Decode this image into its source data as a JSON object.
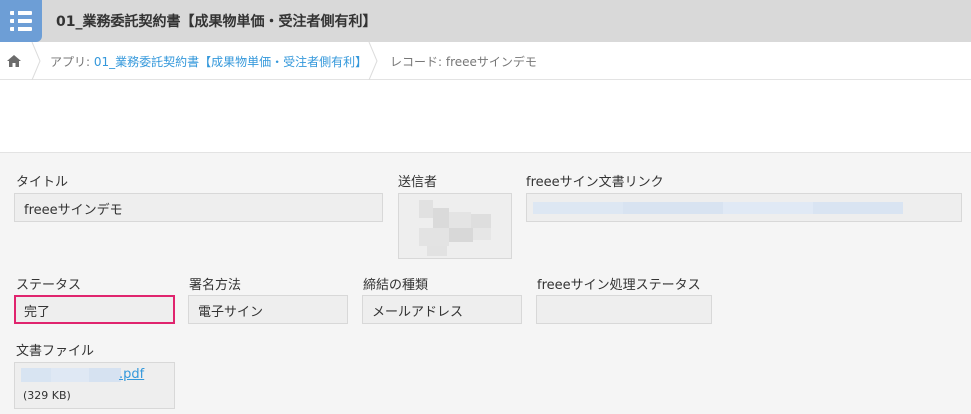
{
  "header": {
    "title": "01_業務委託契約書【成果物単価・受注者側有利】"
  },
  "breadcrumb": {
    "app_prefix": "アプリ: ",
    "app_name": "01_業務委託契約書【成果物単価・受注者側有利】",
    "record": "レコード: freeeサインデモ"
  },
  "fields": {
    "title_label": "タイトル",
    "title_value": "freeeサインデモ",
    "sender_label": "送信者",
    "link_label": "freeeサイン文書リンク",
    "status_label": "ステータス",
    "status_value": "完了",
    "sign_method_label": "署名方法",
    "sign_method_value": "電子サイン",
    "contract_type_label": "締結の種類",
    "contract_type_value": "メールアドレス",
    "process_status_label": "freeeサイン処理ステータス",
    "process_status_value": "",
    "file_label": "文書ファイル",
    "file_ext": ".pdf",
    "file_size": "(329 KB)"
  },
  "colors": {
    "accent": "#3498db",
    "highlight": "#e0246e",
    "app_icon": "#6d9ed6"
  }
}
